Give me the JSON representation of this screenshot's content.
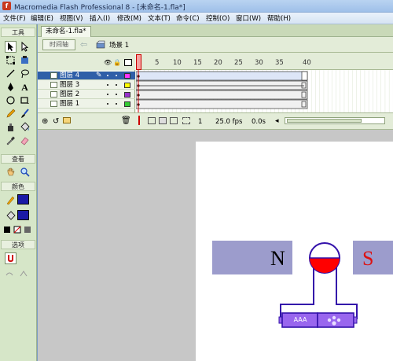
{
  "window": {
    "title": "Macromedia Flash Professional 8 - [未命名-1.fla*]"
  },
  "menu": [
    "文件(F)",
    "编辑(E)",
    "视图(V)",
    "插入(I)",
    "修改(M)",
    "文本(T)",
    "命令(C)",
    "控制(O)",
    "窗口(W)",
    "帮助(H)"
  ],
  "tools": {
    "header": "工具",
    "view_label": "查看",
    "color_label": "颜色",
    "options_label": "选项",
    "icons": [
      "arrow-icon",
      "subselect-icon",
      "free-transform-icon",
      "fill-transform-icon",
      "line-icon",
      "lasso-icon",
      "pen-icon",
      "text-icon",
      "oval-icon",
      "rectangle-icon",
      "pencil-icon",
      "brush-icon",
      "ink-bottle-icon",
      "paint-bucket-icon",
      "eyedropper-icon",
      "eraser-icon",
      "hand-icon",
      "zoom-icon"
    ]
  },
  "document": {
    "tab": "未命名-1.fla*"
  },
  "scene": {
    "timeline_button": "时间轴",
    "label": "场景 1"
  },
  "timeline": {
    "ruler": [
      "5",
      "10",
      "15",
      "20",
      "25",
      "30",
      "35",
      "40"
    ],
    "layers": [
      {
        "name": "图层 4",
        "color": "#ff33ff",
        "selected": true
      },
      {
        "name": "图层 3",
        "color": "#ffff00",
        "selected": false
      },
      {
        "name": "图层 2",
        "color": "#9933cc",
        "selected": false
      },
      {
        "name": "图层 1",
        "color": "#33cc33",
        "selected": false
      }
    ],
    "current_frame": "1",
    "fps": "25.0 fps",
    "time": "0.0s"
  },
  "stage": {
    "n_label": "N",
    "s_label": "S",
    "battery_label": "AAA",
    "colors": {
      "magnet": "#9c9ccc",
      "wire": "#3311aa",
      "battery": "#9966ee",
      "meter_fill": "#ff0000",
      "s_text": "#dd1111"
    }
  }
}
